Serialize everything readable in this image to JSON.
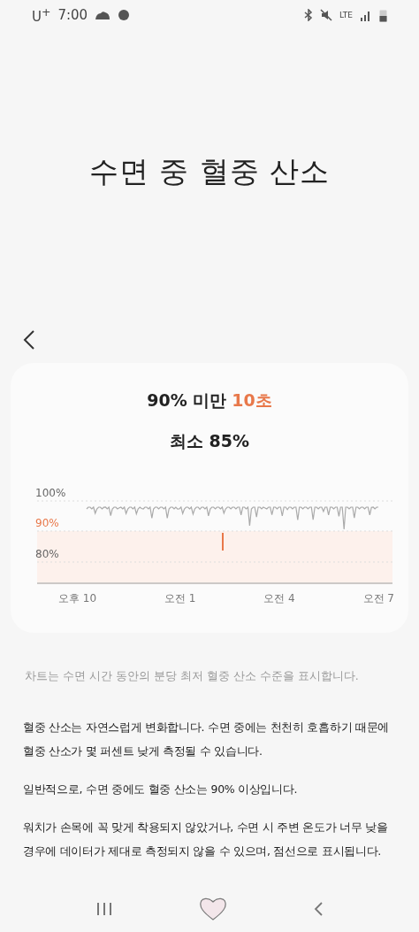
{
  "status_bar": {
    "carrier": "U$^{+}$",
    "time": "7:00",
    "network": "LTE"
  },
  "title": "수면 중 혈중 산소",
  "summary": {
    "threshold_label": "90% 미만",
    "threshold_value": "10초",
    "minimum": "최소 85%"
  },
  "chart": {
    "y_labels": [
      {
        "text": "100%",
        "highlight": false
      },
      {
        "text": "90%",
        "highlight": true
      },
      {
        "text": "80%",
        "highlight": false
      }
    ],
    "x_labels": [
      "오후 10",
      "오전 1",
      "오전 4",
      "오전 7"
    ]
  },
  "caption": "차트는 수면 시간 동안의 분당 최저 혈중 산소 수준을 표시합니다.",
  "paragraphs": [
    "혈중 산소는 자연스럽게 변화합니다. 수면 중에는 천천히 호흡하기 때문에 혈중 산소가 몇 퍼센트 낮게 측정될 수 있습니다.",
    "일반적으로, 수면 중에도 혈중 산소는 90% 이상입니다.",
    "워치가 손목에 꼭 맞게 착용되지 않았거나, 수면 시 주변 온도가 너무 낮을 경우에 데이터가 제대로 측정되지 않을 수 있으며, 점선으로 표시됩니다."
  ]
}
